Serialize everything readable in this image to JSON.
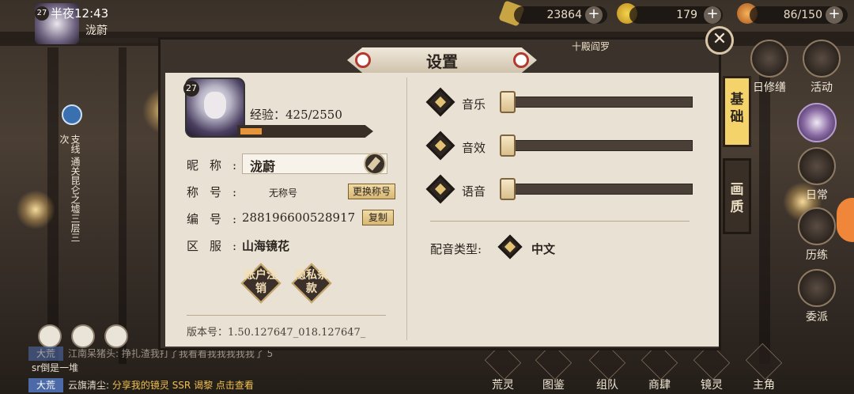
{
  "status": {
    "clock": "半夜12:43"
  },
  "player": {
    "level": "27",
    "name": "泷蔚"
  },
  "resources": [
    {
      "value": "23864",
      "icon": "gold-coin-icon"
    },
    {
      "value": "179",
      "icon": "jade-icon"
    },
    {
      "value": "86/150",
      "icon": "stamina-icon"
    }
  ],
  "dialog": {
    "title": "设置",
    "subtitle": "十殿阎罗",
    "close_icon": "✕",
    "exp_label": "经验：425/2550",
    "exp_progress": 0.167,
    "nickname_label": "昵称:",
    "nickname_value": "泷蔚",
    "title_label": "称号:",
    "title_value": "无称号",
    "change_title_button": "更换称号",
    "id_label": "编号:",
    "id_value": "288196600528917",
    "copy_button": "复制",
    "server_label": "区服:",
    "server_value": "山海镜花",
    "account_button": "账户注销",
    "privacy_button": "隐私条款",
    "version": "版本号：1.50.127647_018.127647_",
    "sound": [
      {
        "label": "音乐",
        "level": 0
      },
      {
        "label": "音效",
        "level": 0
      },
      {
        "label": "语音",
        "level": 0
      }
    ],
    "voice_type_label": "配音类型:",
    "voice_type_value": "中文",
    "tab_basic": "基础",
    "tab_quality": "画质"
  },
  "right_menu": [
    "日修缮",
    "活动",
    "日常",
    "历练",
    "委派"
  ],
  "bottom_menu": [
    "荒灵",
    "图鉴",
    "组队",
    "商肆",
    "镜灵",
    "主角"
  ],
  "left_quest": "支线 通关昆仑之墟三层三次",
  "chat": [
    {
      "tag": "大荒",
      "text": "江南呆猪头:  挣扎渣我打了我看看我我我我我了  5"
    },
    {
      "tag": "",
      "text": "sr倒是一堆"
    },
    {
      "tag": "大荒",
      "speaker": "云旗清尘:",
      "text": "分享我的镜灵 SSR 谒黎",
      "link": "点击查看"
    }
  ],
  "colors": {
    "accent": "#f3d36a",
    "panel": "#e9e1d4",
    "frame": "#3b322b",
    "exp": "#e7953a"
  }
}
